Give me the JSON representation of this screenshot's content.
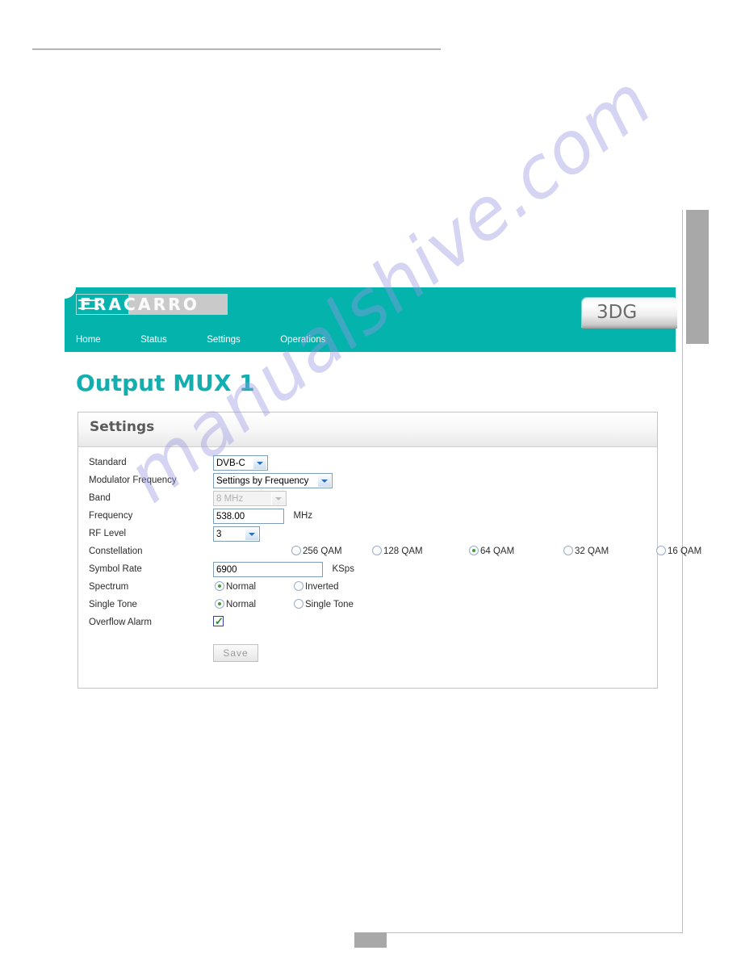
{
  "page": {
    "page_number": ""
  },
  "webui": {
    "brand": {
      "logo_boxed": "FR",
      "logo_rest": "ACARRO",
      "model_tab": "3DG"
    },
    "nav": [
      {
        "label": "Home"
      },
      {
        "label": "Status"
      },
      {
        "label": "Settings"
      },
      {
        "label": "Operations"
      }
    ],
    "page_title": "Output MUX 1",
    "panel": {
      "header": "Settings",
      "rows": {
        "standard": {
          "label": "Standard",
          "value": "DVB-C"
        },
        "modulator_frequency": {
          "label": "Modulator Frequency",
          "value": "Settings by Frequency"
        },
        "band": {
          "label": "Band",
          "value": "8 MHz"
        },
        "frequency": {
          "label": "Frequency",
          "value": "538.00",
          "unit": "MHz"
        },
        "rf_level": {
          "label": "RF Level",
          "value": "3"
        },
        "constellation": {
          "label": "Constellation",
          "options": [
            {
              "label": "256 QAM",
              "selected": false
            },
            {
              "label": "128 QAM",
              "selected": false
            },
            {
              "label": "64 QAM",
              "selected": true
            },
            {
              "label": "32 QAM",
              "selected": false
            },
            {
              "label": "16 QAM",
              "selected": false
            }
          ]
        },
        "symbol_rate": {
          "label": "Symbol Rate",
          "value": "6900",
          "unit": "KSps"
        },
        "spectrum": {
          "label": "Spectrum",
          "options": [
            {
              "label": "Normal",
              "selected": true
            },
            {
              "label": "Inverted",
              "selected": false
            }
          ]
        },
        "single_tone": {
          "label": "Single Tone",
          "options": [
            {
              "label": "Normal",
              "selected": true
            },
            {
              "label": "Single Tone",
              "selected": false
            }
          ]
        },
        "overflow_alarm": {
          "label": "Overflow Alarm",
          "checked": true
        }
      },
      "save_label": "Save"
    }
  },
  "watermark": {
    "text": "manualshive.com"
  },
  "colors": {
    "brand_teal": "#05b3ad",
    "title_teal": "#13aeb0",
    "panel_border": "#c4c4c4",
    "input_border": "#7f9db9",
    "radio_dot_green": "#3a9e3a"
  }
}
